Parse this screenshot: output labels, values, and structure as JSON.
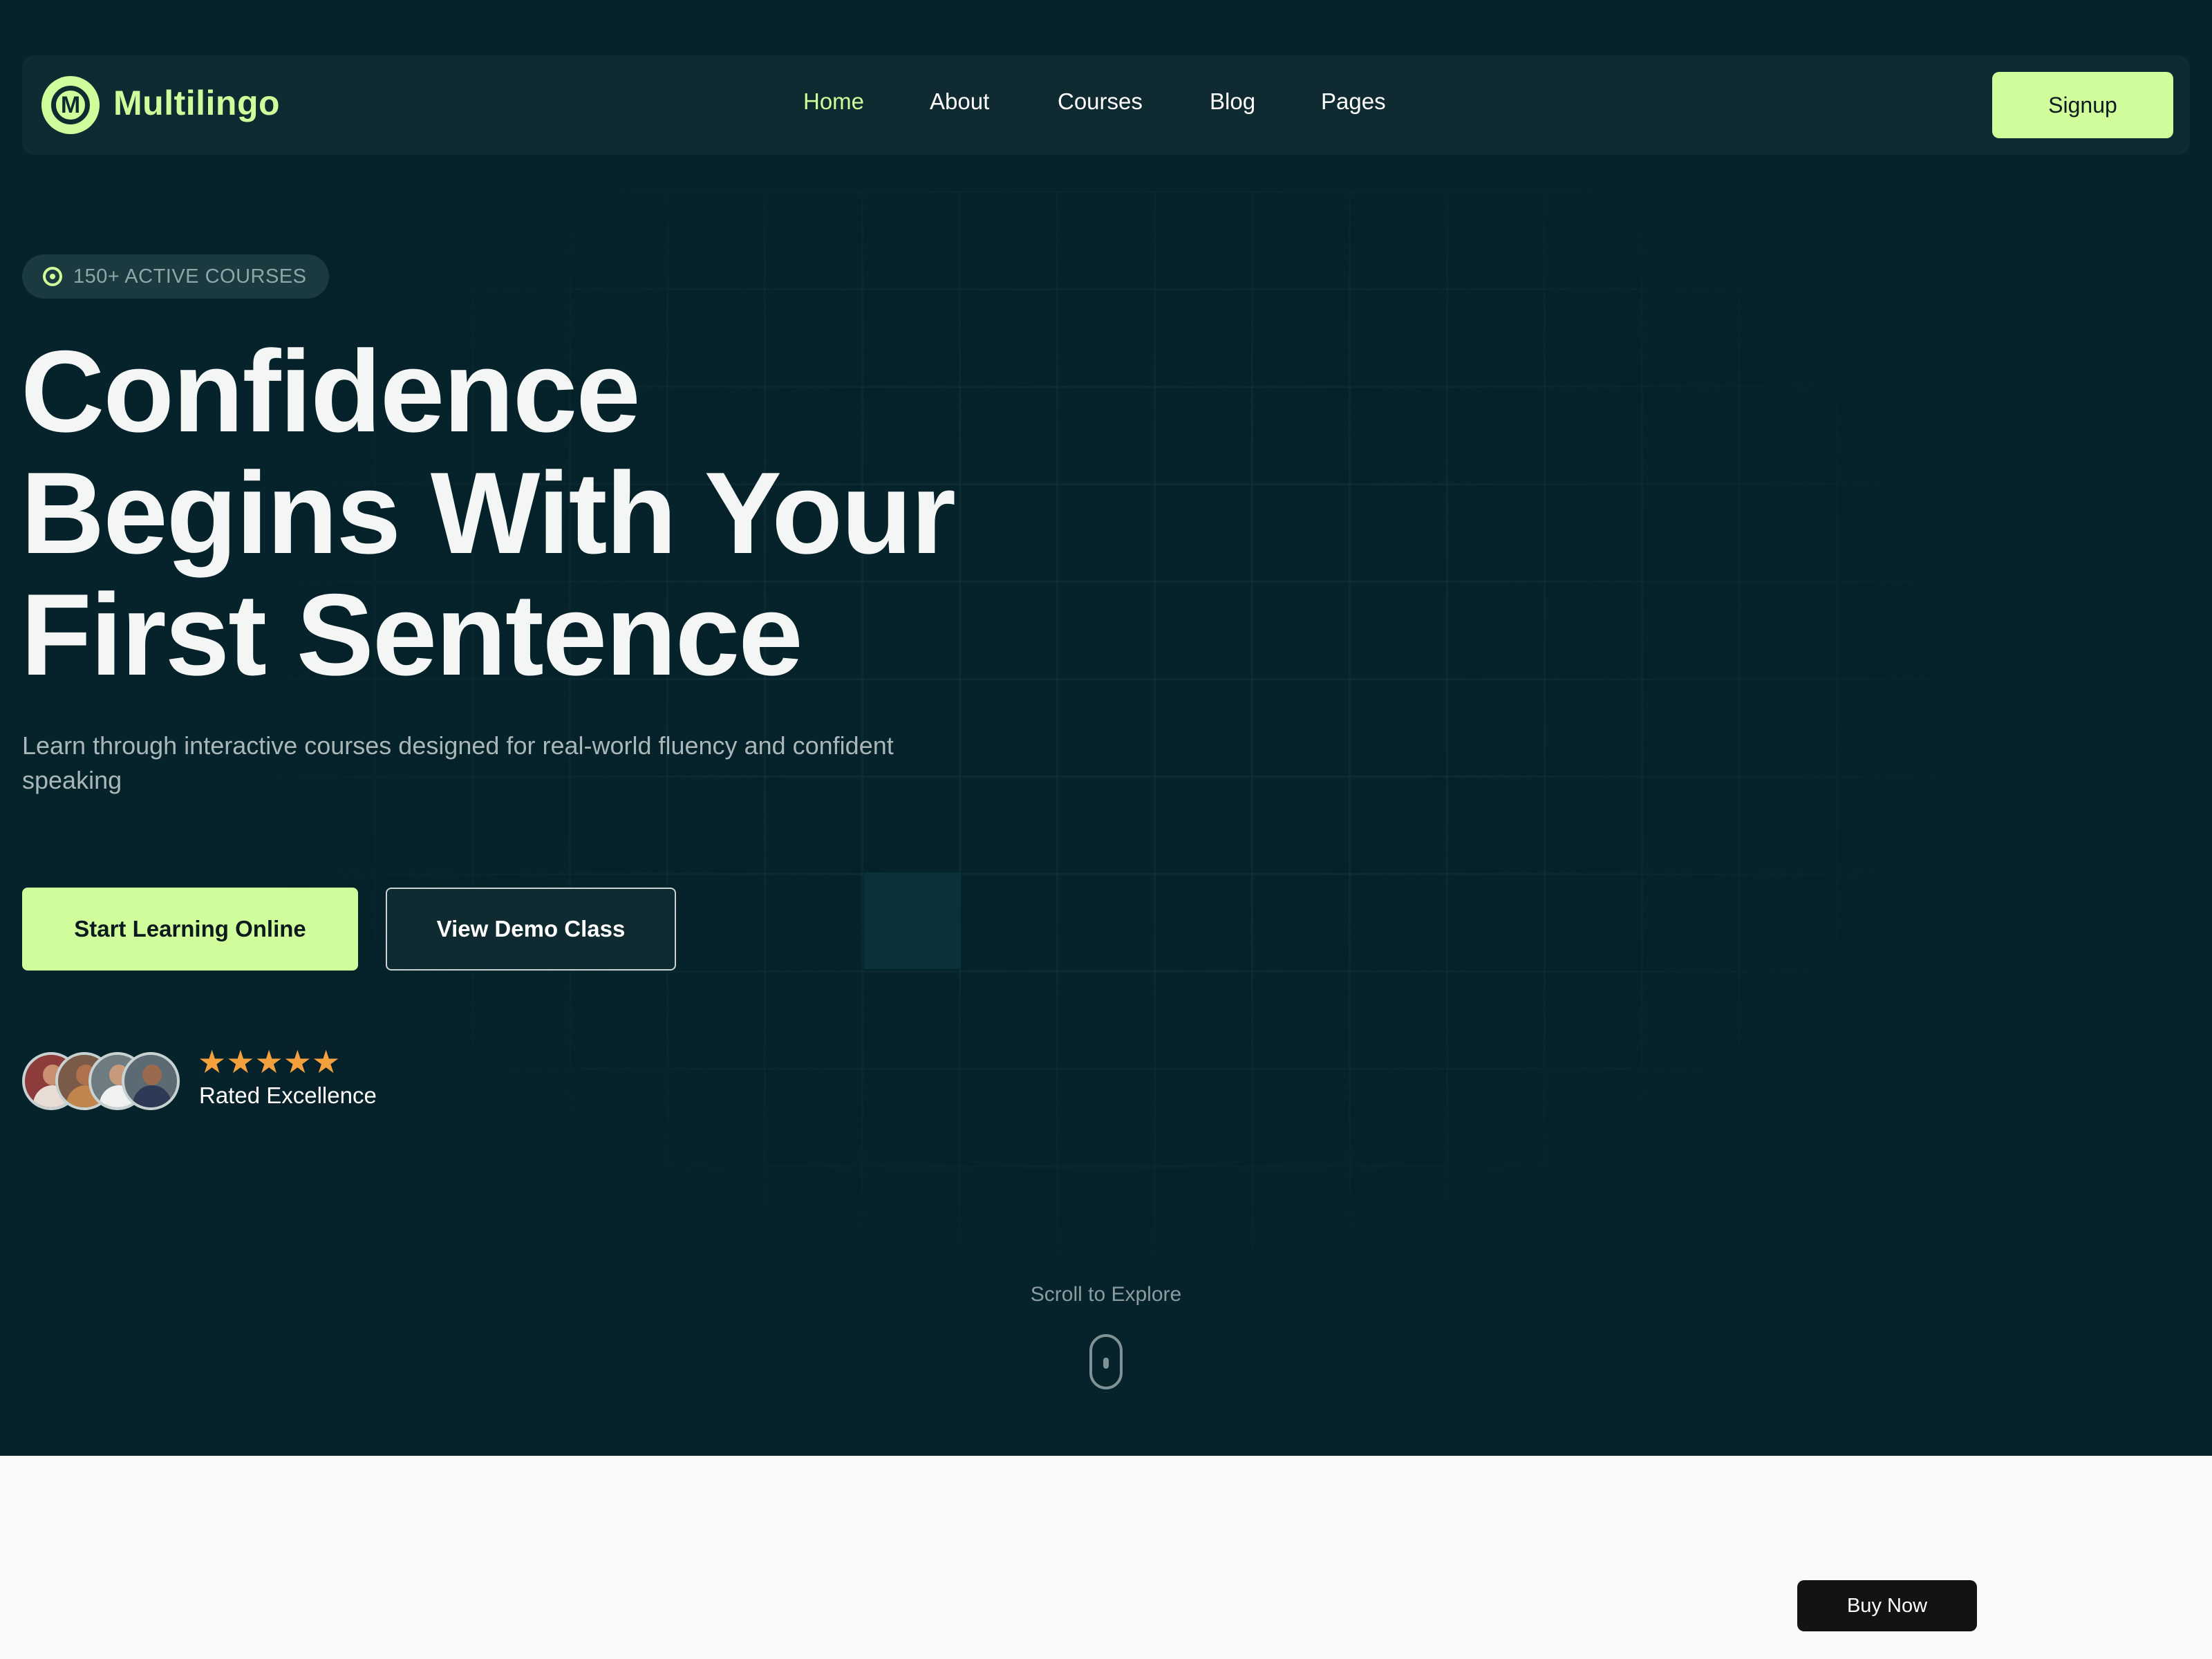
{
  "brand": {
    "name": "Multilingo",
    "logo_letter": "M",
    "logo_icon": "multilingo-logo-icon",
    "accent_color": "#d1fc9b"
  },
  "nav": {
    "links": [
      {
        "label": "Home",
        "active": true
      },
      {
        "label": "About",
        "active": false
      },
      {
        "label": "Courses",
        "active": false
      },
      {
        "label": "Blog",
        "active": false
      },
      {
        "label": "Pages",
        "active": false
      }
    ],
    "signup_label": "Signup"
  },
  "hero": {
    "badge_icon": "target-icon",
    "badge_text": "150+ ACTIVE COURSES",
    "headline_lines": [
      "Confidence",
      "Begins With Your",
      "First Sentence"
    ],
    "subtitle": "Learn through interactive courses designed for real-world fluency and confident speaking",
    "primary_cta": "Start Learning Online",
    "secondary_cta": "View Demo Class",
    "rating": {
      "stars": 5,
      "star_glyphs": "★★★★★",
      "star_color": "#f4a13d",
      "label": "Rated Excellence",
      "avatar_count": 4
    },
    "scroll_hint": "Scroll to Explore",
    "background_color": "#06222a"
  },
  "footer_bar": {
    "buy_now_label": "Buy Now"
  }
}
